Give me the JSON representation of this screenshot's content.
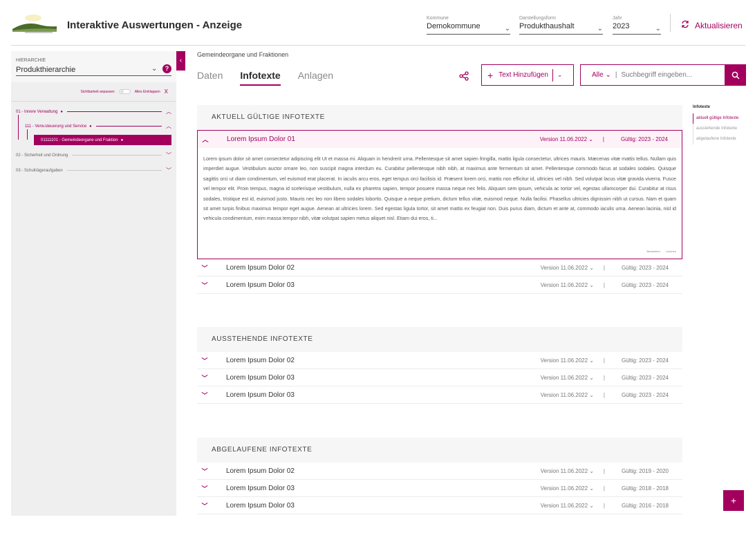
{
  "header": {
    "title": "Interaktive Auswertungen - Anzeige",
    "kommune": {
      "label": "Kommune",
      "value": "Demokommune"
    },
    "darstellung": {
      "label": "Darstellungsform",
      "value": "Produkthaushalt"
    },
    "jahr": {
      "label": "Jahr",
      "value": "2023"
    },
    "refresh_label": "Aktualisieren"
  },
  "sidebar": {
    "label": "HIERARCHIE",
    "value": "Produkthierarchie",
    "help_symbol": "?",
    "visibility_label": "Sichtbarkeit anpassen",
    "collapse_all_label": "Alles Einklappen",
    "collapse_x": "X",
    "tree": [
      {
        "label": "01 - Innere Verwaltung"
      },
      {
        "label": "111 - Verw.steuerung und Service"
      },
      {
        "label": "01111101 - Gemeindeorgane und Fraktion"
      },
      {
        "label": "02 - Sicherheit und Ordnung"
      },
      {
        "label": "03 - Schulträgeraufgaben"
      }
    ]
  },
  "main": {
    "breadcrumb": "Gemeindeorgane und Fraktionen",
    "tabs": [
      {
        "label": "Daten"
      },
      {
        "label": "Infotexte"
      },
      {
        "label": "Anlagen"
      }
    ],
    "add_text_label": "Text Hinzufügen",
    "filter_label": "Alle ⌄",
    "search_placeholder": "Suchbegriff eingeben...",
    "sections": {
      "current": {
        "title": "AKTUELL GÜLTIGE INFOTEXTE",
        "expanded": {
          "title": "Lorem Ipsum Dolor 01",
          "version": "Version 11.06.2022 ⌄",
          "valid": "Gültig: 2023 - 2024",
          "body": "Lorem ipsum dolor sit amet consectetur adipiscing elit Ut et massa mi. Aliquam in hendrerit urna. Pellentesque sit amet sapien fringilla, mattis ligula consectetur, ultrices mauris. Mæcenas vitæ mattis tellus. Nullam quis imperdiet augue. Vestibulum auctor ornare leo, non suscipit magna interdum eu. Curabitur pellentesque nibh nibh, at maximus ante fermentum sit amet. Pellentesque commodo facus at sodales sodales. Quisque sagittis orci ut diam condimentum, vel euismod erat placerat. In iaculis arcu eros, eget tempus orci facilisis id. Præsent lorem orci, mattis non efficitur id, ultricies vel nibh. Sed volutpat lacus vitæ gravida viverra. Fusce vel tempor elit. Proin tempus, magna id scelerisque vestibulum, nulla ex pharetra sapien, tempor posuere massa neque nec felis. Aliquam sem ipsum, vehicula ac tortor vel, egestas ullamcorper dui. Curabitur at risus sodales, tristique est id, euismod justo. Mauris nec leo non libero sodales lobortis. Quisque a neque pretium, dictum tellus vitæ, euismod neque. Nulla facilisi. Phasellus ultricies dignissim nibh ut cursus. Nam et quam sit amet turpis finibus maximus tempor eget augue. Aenean at ultricies lorem. Sed egestas ligula tortor, sit amet mattis ex feugiat non. Duis purus diam, dictum et ante at, commodo iaculis urna. Aenean lacinia, nisl id vehicula condimentum, enim massa tempor nibh, vitæ volutpat sapien metus aliquet nisl. Etiam dui eros, ti...",
          "edit_label": "Bearbeiten",
          "delete_label": "Löschen"
        },
        "rows": [
          {
            "title": "Lorem Ipsum Dolor 02",
            "version": "Version 11.06.2022 ⌄",
            "valid": "Gültig: 2023 - 2024"
          },
          {
            "title": "Lorem Ipsum Dolor 03",
            "version": "Version 11.06.2022 ⌄",
            "valid": "Gültig: 2023 - 2024"
          }
        ]
      },
      "pending": {
        "title": "AUSSTEHENDE INFOTEXTE",
        "rows": [
          {
            "title": "Lorem Ipsum Dolor 02",
            "version": "Version 11.06.2022 ⌄",
            "valid": "Gültig: 2023 - 2024"
          },
          {
            "title": "Lorem Ipsum Dolor 03",
            "version": "Version 11.06.2022 ⌄",
            "valid": "Gültig: 2023 - 2024"
          },
          {
            "title": "Lorem Ipsum Dolor 03",
            "version": "Version 11.06.2022 ⌄",
            "valid": "Gültig: 2023 - 2024"
          }
        ]
      },
      "expired": {
        "title": "ABGELAUFENE INFOTEXTE",
        "rows": [
          {
            "title": "Lorem Ipsum Dolor 02",
            "version": "Version 11.06.2022 ⌄",
            "valid": "Gültig: 2019 - 2020"
          },
          {
            "title": "Lorem Ipsum Dolor 03",
            "version": "Version 11.06.2022 ⌄",
            "valid": "Gültig: 2018 - 2018"
          },
          {
            "title": "Lorem Ipsum Dolor 03",
            "version": "Version 11.06.2022 ⌄",
            "valid": "Gültig: 2016 - 2018"
          }
        ]
      }
    }
  },
  "rail": {
    "title": "Infotexte",
    "items": [
      {
        "label": "aktuell gültige Infotexte"
      },
      {
        "label": "ausstehende Infotexte"
      },
      {
        "label": "abgelaufene Infotexte"
      }
    ]
  },
  "fab_label": "+",
  "colors": {
    "accent": "#a3005e",
    "panel": "#efefef"
  }
}
